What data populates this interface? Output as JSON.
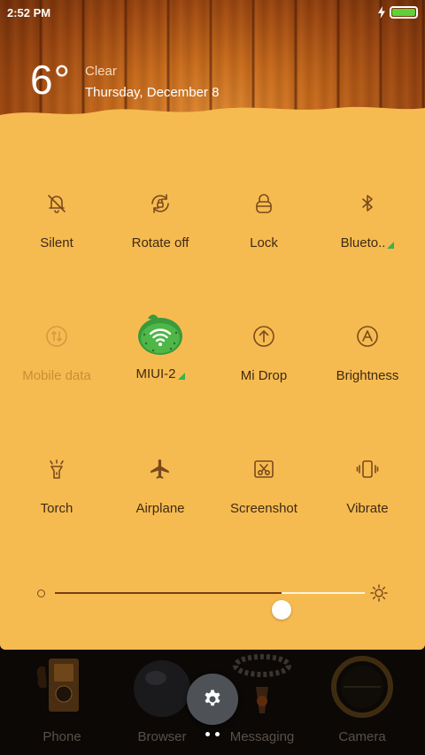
{
  "status_bar": {
    "time": "2:52 PM",
    "battery_color": "#5fd13a"
  },
  "weather": {
    "temperature": "6°",
    "condition": "Clear",
    "date": "Thursday, December 8"
  },
  "toggles": [
    {
      "label": "Silent",
      "icon": "bell-off-icon",
      "dim": false,
      "indicator": false
    },
    {
      "label": "Rotate off",
      "icon": "rotate-lock-icon",
      "dim": false,
      "indicator": false
    },
    {
      "label": "Lock",
      "icon": "lock-icon",
      "dim": false,
      "indicator": false
    },
    {
      "label": "Blueto..",
      "icon": "bluetooth-icon",
      "dim": false,
      "indicator": true
    },
    {
      "label": "Mobile data",
      "icon": "mobile-data-icon",
      "dim": true,
      "indicator": false
    },
    {
      "label": "MIUI-2",
      "icon": "wifi-icon",
      "dim": false,
      "indicator": true,
      "active": true
    },
    {
      "label": "Mi Drop",
      "icon": "mi-drop-icon",
      "dim": false,
      "indicator": false
    },
    {
      "label": "Brightness",
      "icon": "brightness-auto-icon",
      "dim": false,
      "indicator": false
    },
    {
      "label": "Torch",
      "icon": "torch-icon",
      "dim": false,
      "indicator": false
    },
    {
      "label": "Airplane",
      "icon": "airplane-icon",
      "dim": false,
      "indicator": false
    },
    {
      "label": "Screenshot",
      "icon": "screenshot-icon",
      "dim": false,
      "indicator": false
    },
    {
      "label": "Vibrate",
      "icon": "vibrate-icon",
      "dim": false,
      "indicator": false
    }
  ],
  "brightness": {
    "level_percent": 73
  },
  "dock": [
    {
      "label": "Phone",
      "icon": "phone-app-icon"
    },
    {
      "label": "Browser",
      "icon": "browser-app-icon"
    },
    {
      "label": "Messaging",
      "icon": "messaging-app-icon"
    },
    {
      "label": "Camera",
      "icon": "camera-app-icon"
    }
  ],
  "page_indicator": {
    "pages": 2,
    "current": 1
  },
  "colors": {
    "panel": "#f6bb50",
    "icon": "#7a4a1c",
    "accent_green": "#37b24d"
  }
}
